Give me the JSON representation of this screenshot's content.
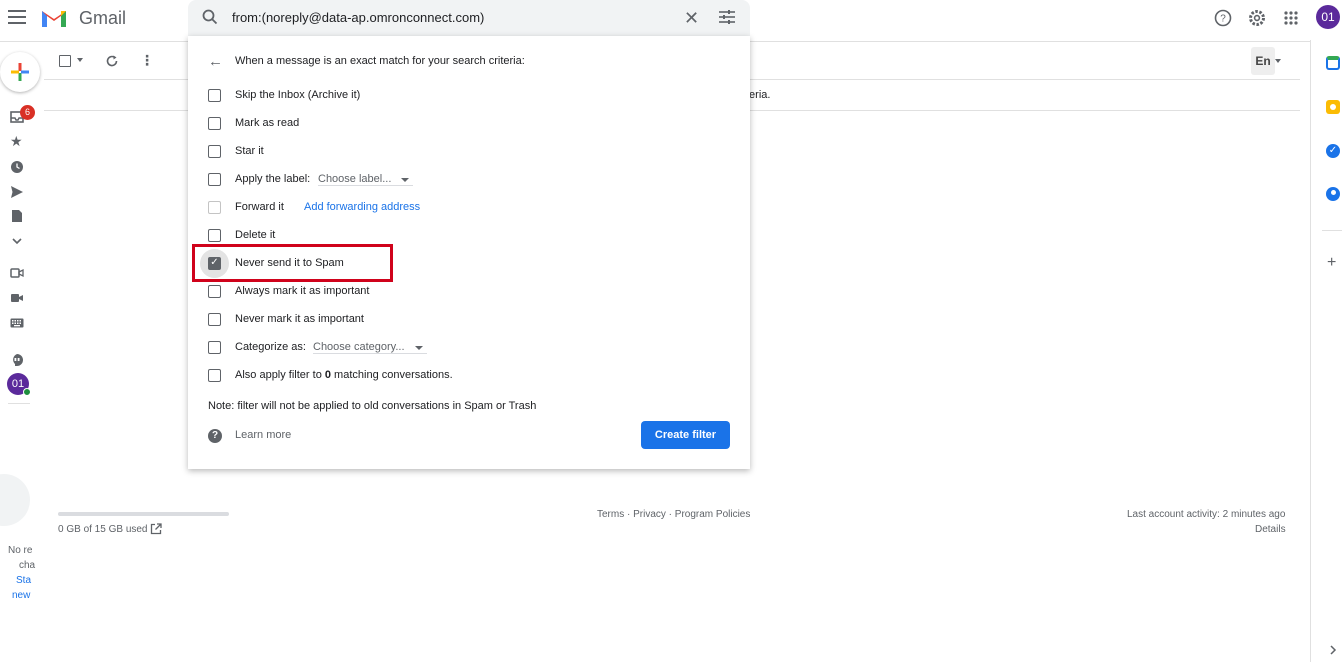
{
  "app": {
    "brand": "Gmail",
    "avatar_initials": "01"
  },
  "search": {
    "query": "from:(noreply@data-ap.omronconnect.com)"
  },
  "left_rail": {
    "inbox_badge": "6",
    "avatar_initials": "01",
    "chat_line1": "No re",
    "chat_line2": "cha",
    "chat_link1": "Sta",
    "chat_link2": "new"
  },
  "toolbar": {
    "input_tool": "En"
  },
  "background": {
    "partial_text": "teria."
  },
  "filter_popup": {
    "header": "When a message is an exact match for your search criteria:",
    "options": [
      {
        "label": "Skip the Inbox (Archive it)",
        "checked": false
      },
      {
        "label": "Mark as read",
        "checked": false
      },
      {
        "label": "Star it",
        "checked": false
      },
      {
        "label": "Apply the label:",
        "checked": false,
        "select": "Choose label..."
      },
      {
        "label": "Forward it",
        "checked": false,
        "link": "Add forwarding address"
      },
      {
        "label": "Delete it",
        "checked": false
      },
      {
        "label": "Never send it to Spam",
        "checked": true
      },
      {
        "label": "Always mark it as important",
        "checked": false
      },
      {
        "label": "Never mark it as important",
        "checked": false
      },
      {
        "label": "Categorize as:",
        "checked": false,
        "select": "Choose category..."
      },
      {
        "label_prefix": "Also apply filter to ",
        "label_count": "0",
        "label_suffix": " matching conversations.",
        "checked": false
      }
    ],
    "note": "Note: filter will not be applied to old conversations in Spam or Trash",
    "learn_more": "Learn more",
    "create_button": "Create filter"
  },
  "footer": {
    "storage": "0 GB of 15 GB used",
    "links": "Terms · Privacy · Program Policies",
    "activity": "Last account activity: 2 minutes ago",
    "details": "Details"
  },
  "colors": {
    "accent": "#1a73e8",
    "highlight": "#d0021b",
    "avatar": "#5b2a9b"
  }
}
